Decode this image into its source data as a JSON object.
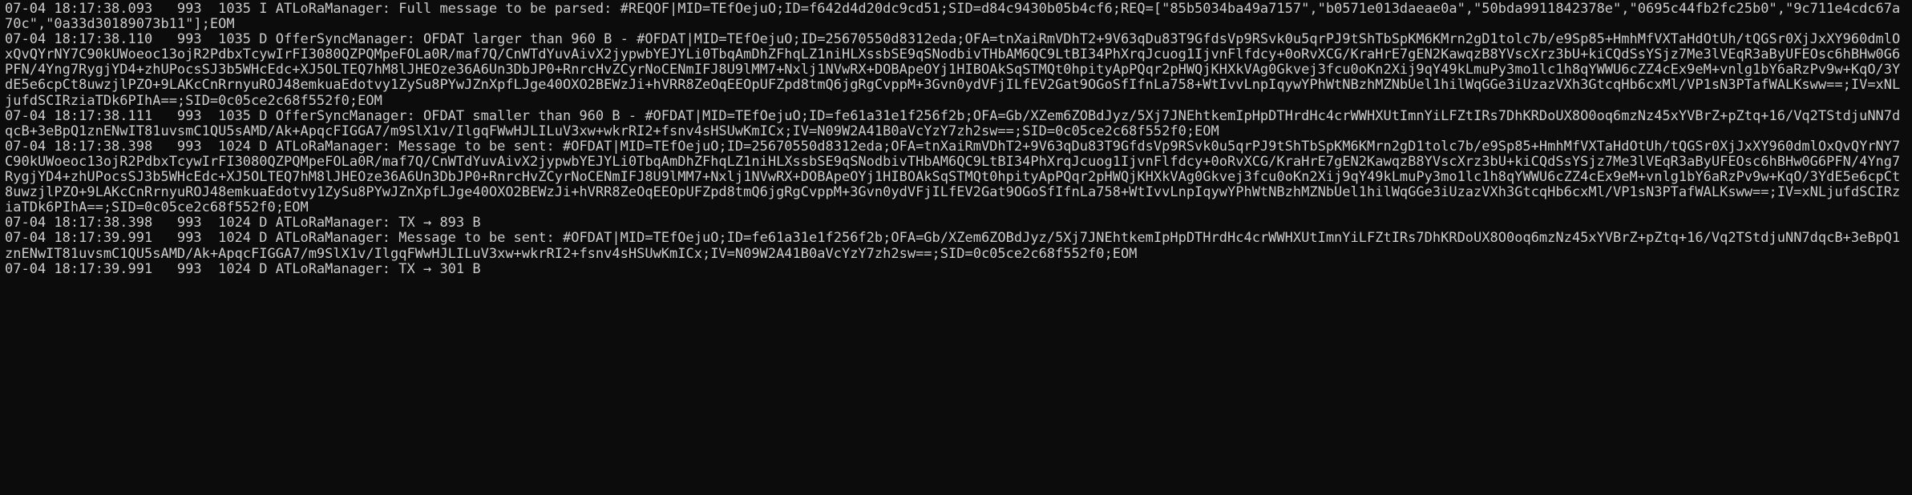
{
  "terminal": {
    "lines": [
      "07-04 18:17:38.093   993  1035 I ATLoRaManager: Full message to be parsed: #REQOF|MID=TEfOejuO;ID=f642d4d20dc9cd51;SID=d84c9430b05b4cf6;REQ=[\"85b5034ba49a7157\",\"b0571e013daeae0a\",\"50bda9911842378e\",\"0695c44fb2fc25b0\",\"9c711e4cdc67a70c\",\"0a33d30189073b11\"];EOM",
      "07-04 18:17:38.110   993  1035 D OfferSyncManager: OFDAT larger than 960 B - #OFDAT|MID=TEfOejuO;ID=25670550d8312eda;OFA=tnXaiRmVDhT2+9V63qDu83T9GfdsVp9RSvk0u5qrPJ9tShTbSpKM6KMrn2gD1tolc7b/e9Sp85+HmhMfVXTaHdOtUh/tQGSr0XjJxXY960dmlOxQvQYrNY7C90kUWoeoc13ojR2PdbxTcywIrFI3080QZPQMpeFOLa0R/maf7Q/CnWTdYuvAivX2jypwbYEJYLi0TbqAmDhZFhqLZ1niHLXssbSE9qSNodbivTHbAM6QC9LtBI34PhXrqJcuog1IjvnFlfdcy+0oRvXCG/KraHrE7gEN2KawqzB8YVscXrz3bU+kiCQdSsYSjz7Me3lVEqR3aByUFEOsc6hBHw0G6PFN/4Yng7RygjYD4+zhUPocsSJ3b5WHcEdc+XJ5OLTEQ7hM8lJHEOze36A6Un3DbJP0+RnrcHvZCyrNoCENmIFJ8U9lMM7+Nxlj1NVwRX+DOBApeOYj1HIBOAkSqSTMQt0hpityApPQqr2pHWQjKHXkVAg0Gkvej3fcu0oKn2Xij9qY49kLmuPy3mo1lc1h8qYWWU6cZZ4cEx9eM+vnlg1bY6aRzPv9w+KqO/3YdE5e6cpCt8uwzjlPZO+9LAKcCnRrnyuROJ48emkuaEdotvy1ZySu8PYwJZnXpfLJge40OXO2BEWzJi+hVRR8ZeOqEEOpUFZpd8tmQ6jgRgCvppM+3Gvn0ydVFjILfEV2Gat9OGoSfIfnLa758+WtIvvLnpIqywYPhWtNBzhMZNbUel1hilWqGGe3iUzazVXh3GtcqHb6cxMl/VP1sN3PTafWALKsww==;IV=xNLjufdSCIRziaTDk6PIhA==;SID=0c05ce2c68f552f0;EOM",
      "07-04 18:17:38.111   993  1035 D OfferSyncManager: OFDAT smaller than 960 B - #OFDAT|MID=TEfOejuO;ID=fe61a31e1f256f2b;OFA=Gb/XZem6ZOBdJyz/5Xj7JNEhtkemIpHpDTHrdHc4crWWHXUtImnYiLFZtIRs7DhKRDoUX8O0oq6mzNz45xYVBrZ+pZtq+16/Vq2TStdjuNN7dqcB+3eBpQ1znENwIT81uvsmC1QU5sAMD/Ak+ApqcFIGGA7/m9SlX1v/IlgqFWwHJLILuV3xw+wkrRI2+fsnv4sHSUwKmICx;IV=N09W2A41B0aVcYzY7zh2sw==;SID=0c05ce2c68f552f0;EOM",
      "07-04 18:17:38.398   993  1024 D ATLoRaManager: Message to be sent: #OFDAT|MID=TEfOejuO;ID=25670550d8312eda;OFA=tnXaiRmVDhT2+9V63qDu83T9GfdsVp9RSvk0u5qrPJ9tShTbSpKM6KMrn2gD1tolc7b/e9Sp85+HmhMfVXTaHdOtUh/tQGSr0XjJxXY960dmlOxQvQYrNY7C90kUWoeoc13ojR2PdbxTcywIrFI3080QZPQMpeFOLa0R/maf7Q/CnWTdYuvAivX2jypwbYEJYLi0TbqAmDhZFhqLZ1niHLXssbSE9qSNodbivTHbAM6QC9LtBI34PhXrqJcuog1IjvnFlfdcy+0oRvXCG/KraHrE7gEN2KawqzB8YVscXrz3bU+kiCQdSsYSjz7Me3lVEqR3aByUFEOsc6hBHw0G6PFN/4Yng7RygjYD4+zhUPocsSJ3b5WHcEdc+XJ5OLTEQ7hM8lJHEOze36A6Un3DbJP0+RnrcHvZCyrNoCENmIFJ8U9lMM7+Nxlj1NVwRX+DOBApeOYj1HIBOAkSqSTMQt0hpityApPQqr2pHWQjKHXkVAg0Gkvej3fcu0oKn2Xij9qY49kLmuPy3mo1lc1h8qYWWU6cZZ4cEx9eM+vnlg1bY6aRzPv9w+KqO/3YdE5e6cpCt8uwzjlPZO+9LAKcCnRrnyuROJ48emkuaEdotvy1ZySu8PYwJZnXpfLJge40OXO2BEWzJi+hVRR8ZeOqEEOpUFZpd8tmQ6jgRgCvppM+3Gvn0ydVFjILfEV2Gat9OGoSfIfnLa758+WtIvvLnpIqywYPhWtNBzhMZNbUel1hilWqGGe3iUzazVXh3GtcqHb6cxMl/VP1sN3PTafWALKsww==;IV=xNLjufdSCIRziaTDk6PIhA==;SID=0c05ce2c68f552f0;EOM",
      "07-04 18:17:38.398   993  1024 D ATLoRaManager: TX → 893 B",
      "07-04 18:17:39.991   993  1024 D ATLoRaManager: Message to be sent: #OFDAT|MID=TEfOejuO;ID=fe61a31e1f256f2b;OFA=Gb/XZem6ZOBdJyz/5Xj7JNEhtkemIpHpDTHrdHc4crWWHXUtImnYiLFZtIRs7DhKRDoUX8O0oq6mzNz45xYVBrZ+pZtq+16/Vq2TStdjuNN7dqcB+3eBpQ1znENwIT81uvsmC1QU5sAMD/Ak+ApqcFIGGA7/m9SlX1v/IlgqFWwHJLILuV3xw+wkrRI2+fsnv4sHSUwKmICx;IV=N09W2A41B0aVcYzY7zh2sw==;SID=0c05ce2c68f552f0;EOM",
      "07-04 18:17:39.991   993  1024 D ATLoRaManager: TX → 301 B"
    ]
  }
}
